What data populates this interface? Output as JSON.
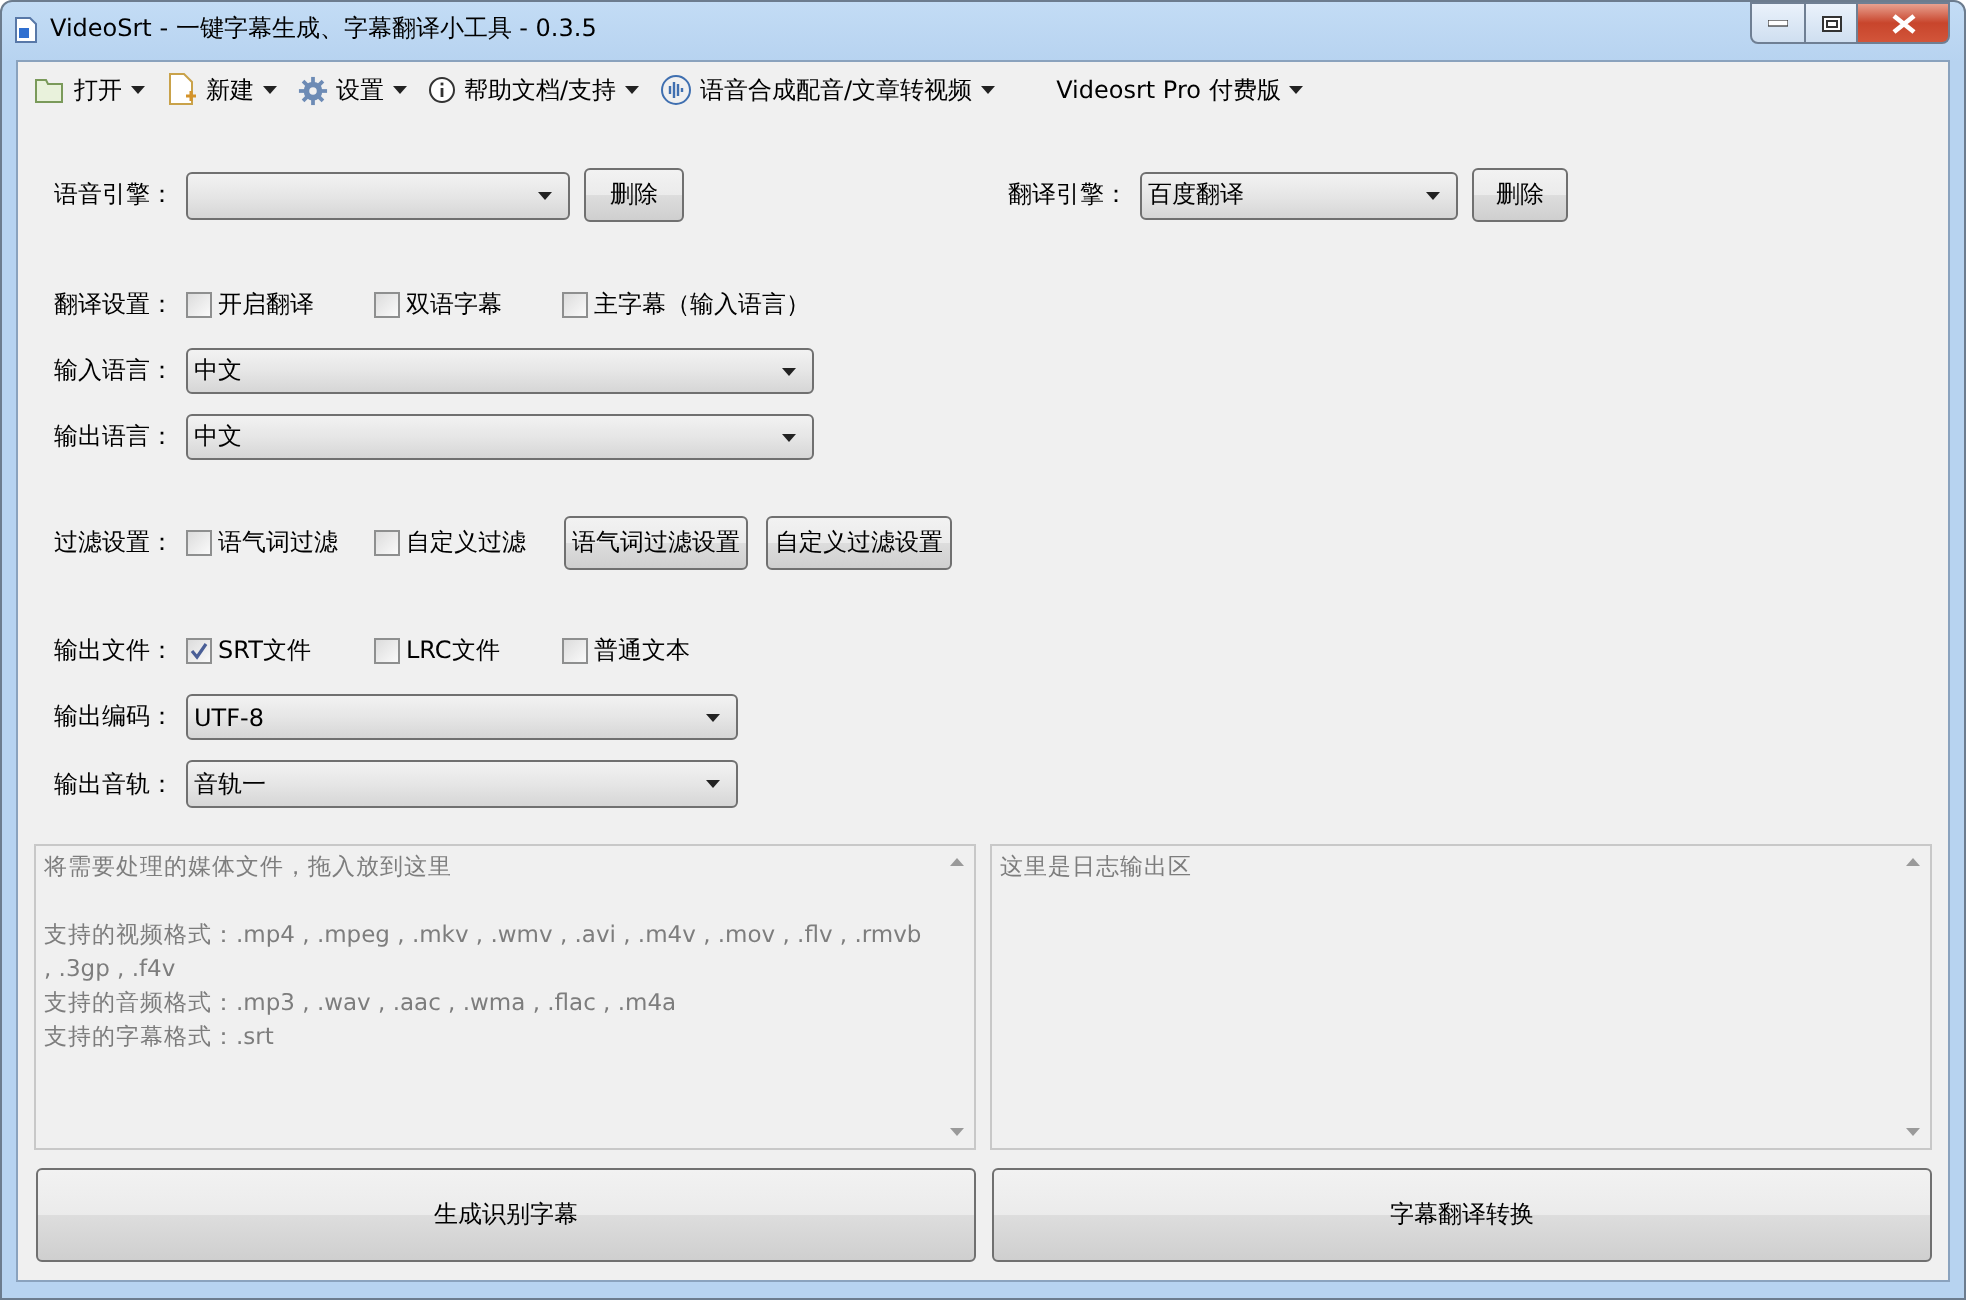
{
  "window": {
    "title": "VideoSrt - 一键字幕生成、字幕翻译小工具 - 0.3.5"
  },
  "menu": [
    {
      "kind": "folder",
      "label": "打开"
    },
    {
      "kind": "new-file",
      "label": "新建"
    },
    {
      "kind": "gear",
      "label": "设置"
    },
    {
      "kind": "info",
      "label": "帮助文档/支持"
    },
    {
      "kind": "wave",
      "label": "语音合成配音/文章转视频"
    },
    {
      "kind": "plain",
      "label": "Videosrt Pro 付费版"
    }
  ],
  "speech_engine": {
    "label": "语音引擎：",
    "button": "删除"
  },
  "translate_engine": {
    "label": "翻译引擎：",
    "value": "百度翻译",
    "button": "删除"
  },
  "translation_settings": {
    "label": "翻译设置：",
    "options": [
      {
        "label": "开启翻译",
        "checked": false
      },
      {
        "label": "双语字幕",
        "checked": false
      },
      {
        "label": "主字幕（输入语言）",
        "checked": false
      }
    ]
  },
  "input_language": {
    "label": "输入语言：",
    "value": "中文"
  },
  "output_language": {
    "label": "输出语言：",
    "value": "中文"
  },
  "filter_settings": {
    "label": "过滤设置：",
    "options": [
      {
        "label": "语气词过滤",
        "checked": false
      },
      {
        "label": "自定义过滤",
        "checked": false
      }
    ],
    "buttons": [
      "语气词过滤设置",
      "自定义过滤设置"
    ]
  },
  "output_files": {
    "label": "输出文件：",
    "options": [
      {
        "label": "SRT文件",
        "checked": true
      },
      {
        "label": "LRC文件",
        "checked": false
      },
      {
        "label": "普通文本",
        "checked": false
      }
    ]
  },
  "output_encoding": {
    "label": "输出编码：",
    "value": "UTF-8"
  },
  "output_track": {
    "label": "输出音轨：",
    "value": "音轨一"
  },
  "media_area": {
    "heading": "将需要处理的媒体文件，拖入放到这里",
    "lines": [
      "支持的视频格式：.mp4 , .mpeg , .mkv , .wmv , .avi , .m4v , .mov , .flv , .rmvb , .3gp , .f4v",
      "支持的音频格式：.mp3 , .wav , .aac , .wma , .flac , .m4a",
      "支持的字幕格式：.srt"
    ]
  },
  "log_area": {
    "heading": "这里是日志输出区"
  },
  "actions": [
    "生成识别字幕",
    "字幕翻译转换"
  ]
}
